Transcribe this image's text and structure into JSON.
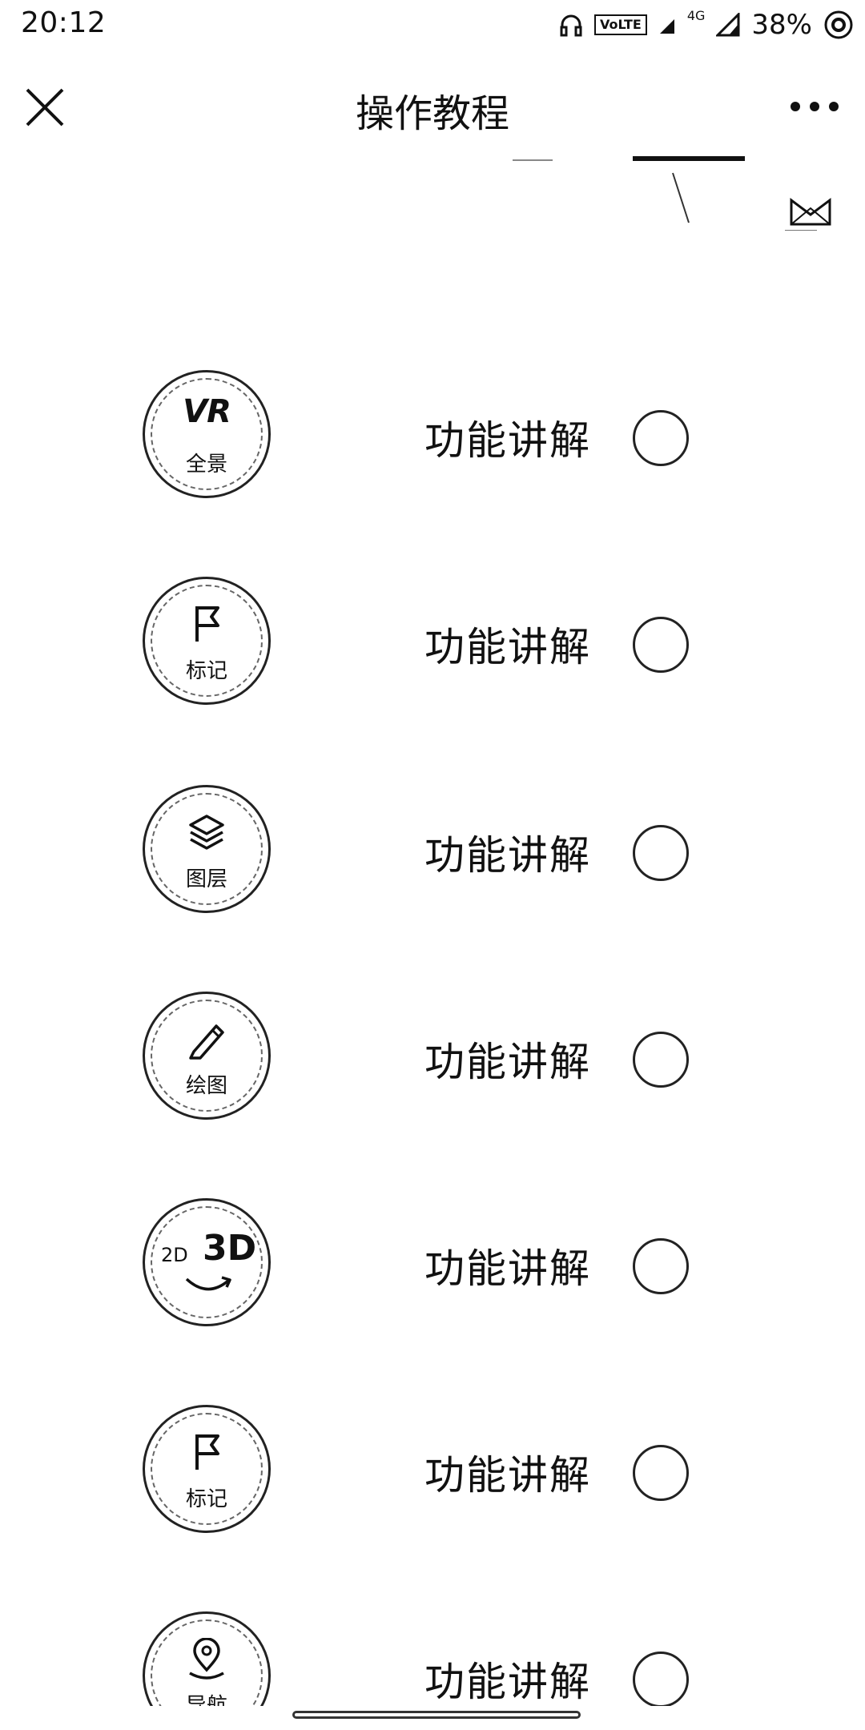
{
  "status_bar": {
    "time": "20:12",
    "volte": "VoLTE",
    "network": "4G",
    "battery": "38%"
  },
  "nav": {
    "title": "操作教程",
    "close_icon": "close-icon",
    "more_icon": "more-icon"
  },
  "items": [
    {
      "badge_label": "全景",
      "badge_text": "VR",
      "icon": "vr-icon",
      "title": "功能讲解"
    },
    {
      "badge_label": "标记",
      "icon": "flag-icon",
      "title": "功能讲解"
    },
    {
      "badge_label": "图层",
      "icon": "layers-icon",
      "title": "功能讲解"
    },
    {
      "badge_label": "绘图",
      "icon": "pencil-icon",
      "title": "功能讲解"
    },
    {
      "badge_text_2d": "2D",
      "badge_text_3d": "3D",
      "icon": "2d-3d-switch-icon",
      "title": "功能讲解"
    },
    {
      "badge_label": "标记",
      "icon": "flag-icon",
      "title": "功能讲解"
    },
    {
      "badge_label": "导航",
      "icon": "location-pin-icon",
      "title": "功能讲解"
    }
  ]
}
